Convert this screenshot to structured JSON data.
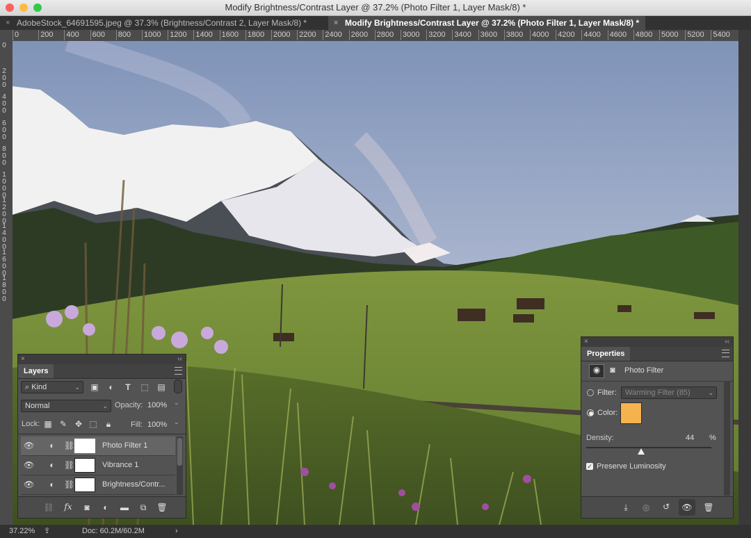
{
  "window": {
    "title": "Modify Brightness/Contrast Layer @ 37.2% (Photo Filter 1, Layer Mask/8) *",
    "colors": {
      "close": "#fc605c",
      "minimize": "#fdbc40",
      "zoom": "#34c84a"
    }
  },
  "tabs": [
    {
      "close": "×",
      "label": "AdobeStock_64691595.jpeg @ 37.3% (Brightness/Contrast 2, Layer Mask/8) *",
      "active": false
    },
    {
      "close": "×",
      "label": "Modify Brightness/Contrast Layer @ 37.2% (Photo Filter 1, Layer Mask/8) *",
      "active": true
    }
  ],
  "ruler": {
    "top": [
      "0",
      "200",
      "400",
      "600",
      "800",
      "1000",
      "1200",
      "1400",
      "1600",
      "1800",
      "2000",
      "2200",
      "2400",
      "2600",
      "2800",
      "3000",
      "3200",
      "3400",
      "3600",
      "3800",
      "4000",
      "4200",
      "4400",
      "4600",
      "4800",
      "5000",
      "5200",
      "5400"
    ],
    "left": [
      "0",
      "200",
      "400",
      "600",
      "800",
      "1000",
      "1200",
      "1400",
      "1600",
      "1800"
    ]
  },
  "layers_panel": {
    "close": "×",
    "collapse": "‹‹",
    "title": "Layers",
    "filter": {
      "label": "Kind",
      "search_icon": "⌕",
      "icons": [
        "image-filter-icon",
        "adjustment-filter-icon",
        "type-filter-icon",
        "shape-filter-icon",
        "smart-object-filter-icon"
      ],
      "type_glyph": "T"
    },
    "blend_mode": "Normal",
    "opacity": {
      "label": "Opacity:",
      "value": "100%"
    },
    "lock": {
      "label": "Lock:"
    },
    "fill": {
      "label": "Fill:",
      "value": "100%"
    },
    "layers": [
      {
        "name": "Photo Filter 1",
        "selected": true
      },
      {
        "name": "Vibrance 1",
        "selected": false
      },
      {
        "name": "Brightness/Contr...",
        "selected": false
      }
    ],
    "footer_fx": "fx"
  },
  "properties_panel": {
    "close": "×",
    "collapse": "‹‹",
    "title": "Properties",
    "adjustment_name": "Photo Filter",
    "filter": {
      "label": "Filter:",
      "value": "Warming Filter (85)"
    },
    "color": {
      "label": "Color:",
      "swatch": "#f5b34f"
    },
    "density": {
      "label": "Density:",
      "value": "44",
      "unit": "%",
      "level": 0.44
    },
    "preserve_luminosity": {
      "label": "Preserve Luminosity",
      "checked": true
    }
  },
  "status": {
    "zoom": "37.22%",
    "doc": "Doc: 60.2M/60.2M",
    "arrow": "›"
  }
}
